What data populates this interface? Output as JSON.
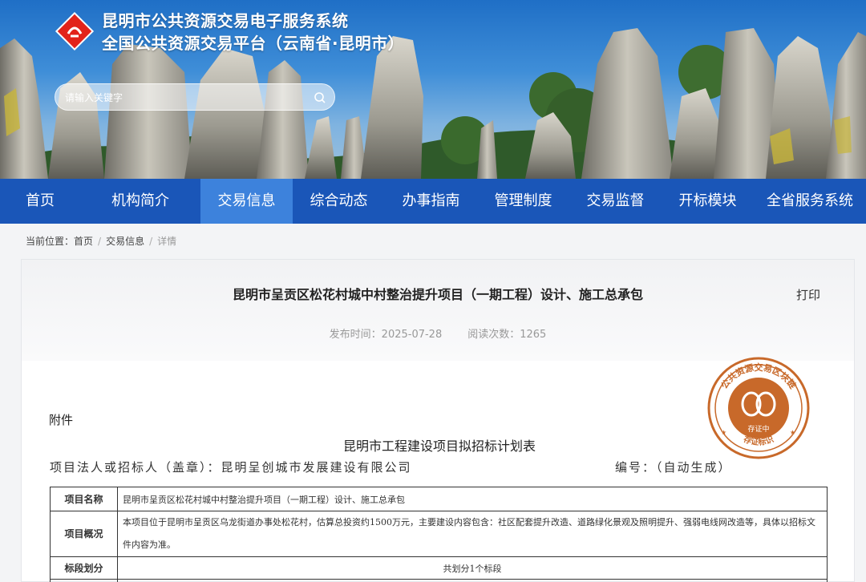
{
  "header": {
    "title_line1": "昆明市公共资源交易电子服务系统",
    "title_line2": "全国公共资源交易平台（云南省·昆明市）",
    "search_placeholder": "请输入关键字"
  },
  "nav": {
    "items": [
      {
        "label": "首页"
      },
      {
        "label": "机构简介"
      },
      {
        "label": "交易信息",
        "active": true
      },
      {
        "label": "综合动态"
      },
      {
        "label": "办事指南"
      },
      {
        "label": "管理制度"
      },
      {
        "label": "交易监督"
      },
      {
        "label": "开标模块"
      },
      {
        "label": "全省服务系统"
      }
    ]
  },
  "breadcrumb": {
    "prefix": "当前位置：",
    "items": [
      "首页",
      "交易信息",
      "详情"
    ]
  },
  "article": {
    "title": "昆明市呈贡区松花村城中村整治提升项目（一期工程）设计、施工总承包",
    "print_label": "打印",
    "publish_label": "发布时间：2025-07-28",
    "views_label": "阅读次数：1265"
  },
  "document": {
    "attachment_label": "附件",
    "doc_title": "昆明市工程建设项目拟招标计划表",
    "applicant": "项目法人或招标人（盖章）：昆明呈创城市发展建设有限公司",
    "serial": "编号：（自动生成）",
    "seal": {
      "top_text": "公共资源交易区块链",
      "middle_text": "存证中",
      "bottom_text": "存证标识",
      "color": "#c8692a"
    },
    "table": {
      "rows": [
        {
          "label": "项目名称",
          "value": "昆明市呈贡区松花村城中村整治提升项目（一期工程）设计、施工总承包"
        },
        {
          "label": "项目概况",
          "value": "本项目位于昆明市呈贡区乌龙街道办事处松花村，估算总投资约1500万元，主要建设内容包含：社区配套提升改造、道路绿化景观及照明提升、强弱电线网改造等，具体以招标文件内容为准。"
        },
        {
          "label": "标段划分",
          "value": "共划分1个标段"
        }
      ]
    }
  },
  "colors": {
    "nav_bg": "#1a56b8",
    "nav_active": "#3d82dc"
  }
}
